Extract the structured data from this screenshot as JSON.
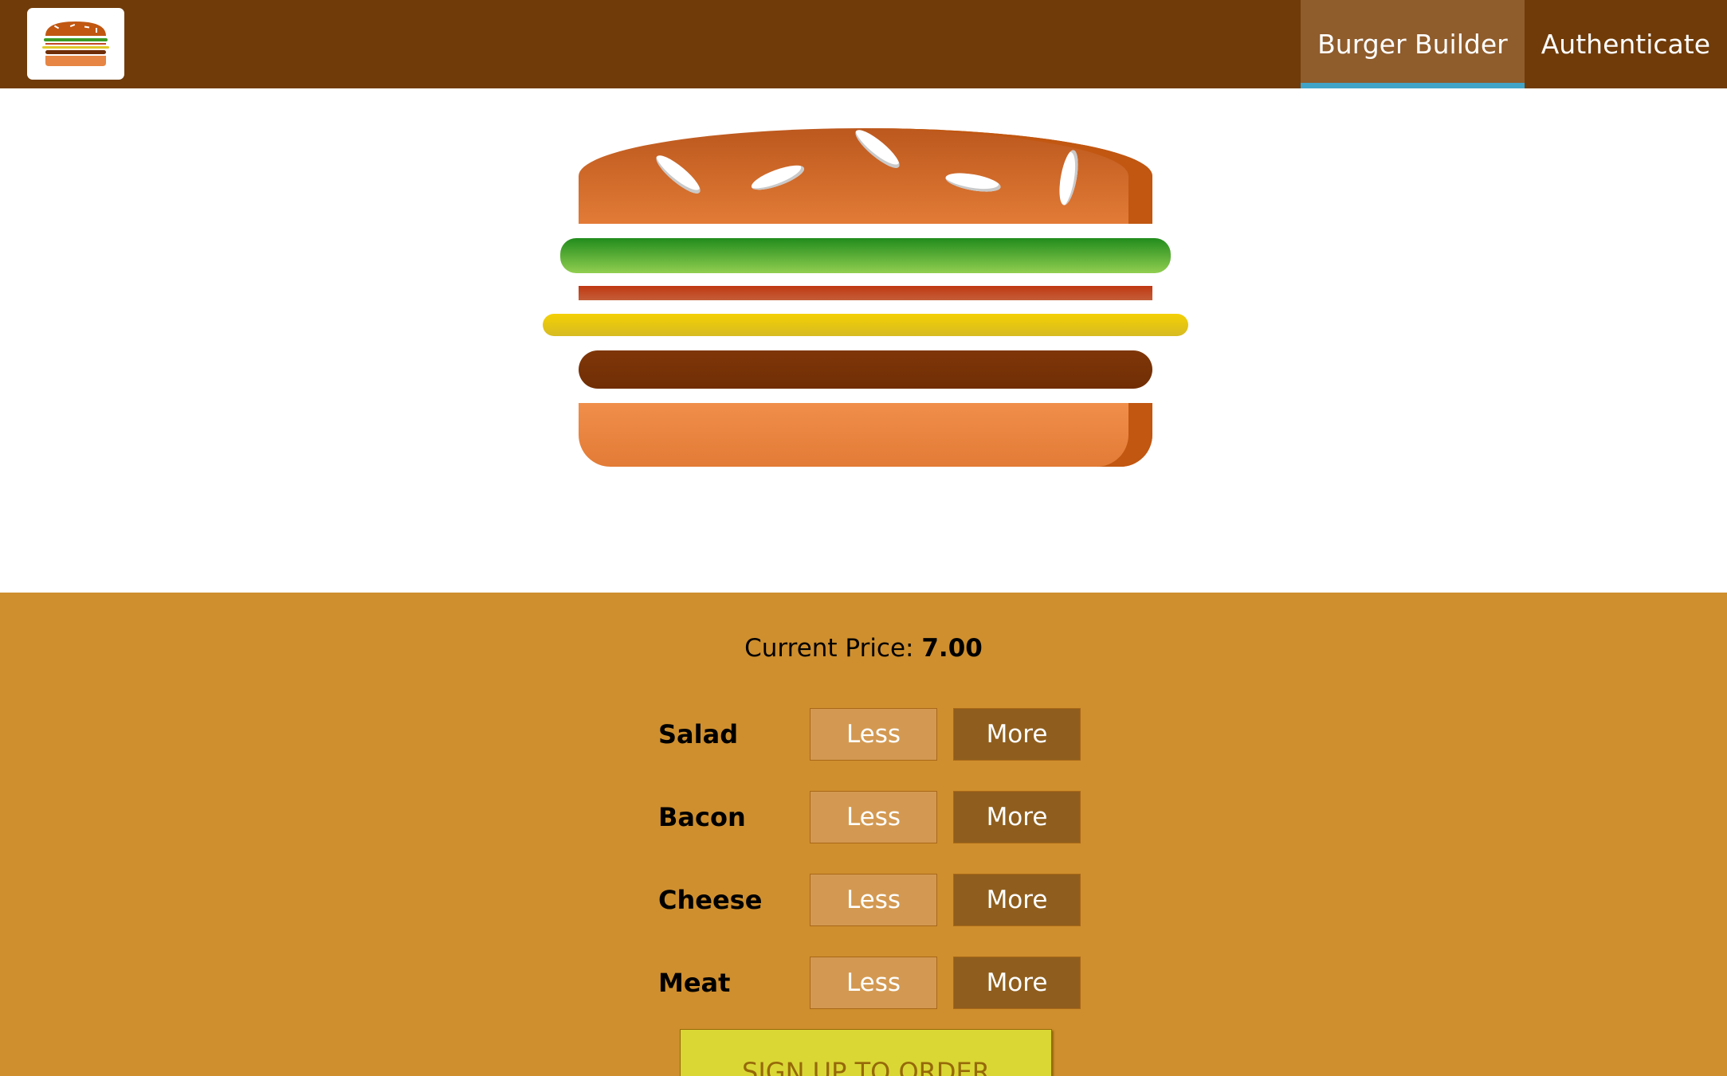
{
  "toolbar": {
    "logo_alt": "burger-logo",
    "nav": [
      {
        "label": "Burger Builder",
        "active": true
      },
      {
        "label": "Authenticate",
        "active": false
      }
    ]
  },
  "build_controls": {
    "price_label": "Current Price:",
    "price_value": "7.00",
    "controls": [
      {
        "label": "Salad",
        "less": "Less",
        "more": "More"
      },
      {
        "label": "Bacon",
        "less": "Less",
        "more": "More"
      },
      {
        "label": "Cheese",
        "less": "Less",
        "more": "More"
      },
      {
        "label": "Meat",
        "less": "Less",
        "more": "More"
      }
    ],
    "order_button": "SIGN UP TO ORDER"
  },
  "colors": {
    "toolbar": "#703b09",
    "active_nav_underline": "#40a4c8",
    "controls_background": "#cf8f2e",
    "less_button": "#d39952",
    "more_button": "#8f5e1e",
    "order_button": "#dad735"
  }
}
